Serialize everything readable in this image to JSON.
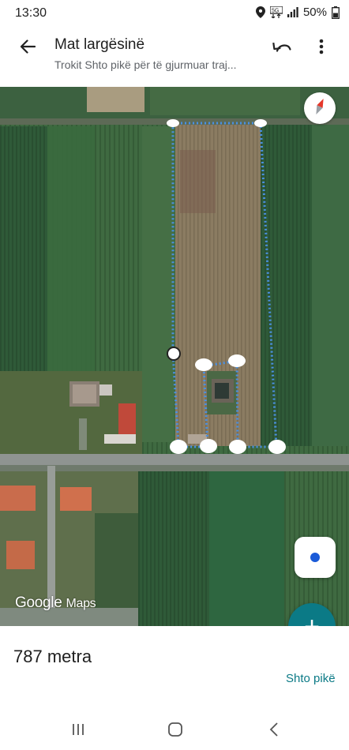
{
  "status_bar": {
    "time": "13:30",
    "battery": "50%",
    "icons": [
      "location-icon",
      "network-icon",
      "signal-icon",
      "battery-icon"
    ]
  },
  "app_bar": {
    "title": "Mat largësinë",
    "subtitle": "Trokit Shto pikë për të gjurmuar traj...",
    "icons": [
      "back-arrow-icon",
      "undo-icon",
      "more-vert-icon"
    ]
  },
  "map": {
    "attribution": "Google",
    "attribution_product": "Maps",
    "compass_icon": "compass-icon",
    "location_icon": "my-location-icon",
    "measure_line_color": "#4a90e2"
  },
  "fab": {
    "label": "+"
  },
  "bottom_panel": {
    "distance": "787 metra",
    "add_point": "Shto pikë"
  },
  "nav_bar": {
    "icons": [
      "recents-icon",
      "home-icon",
      "back-icon"
    ]
  }
}
